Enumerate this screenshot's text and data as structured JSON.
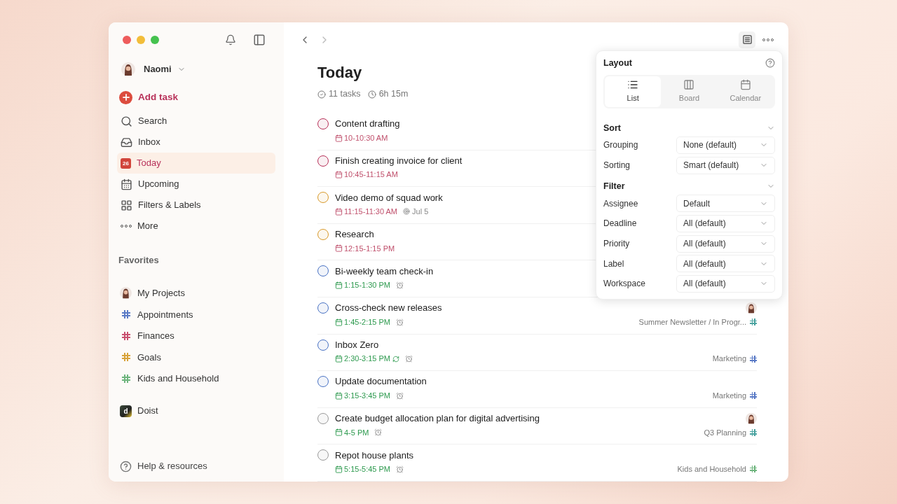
{
  "sidebar": {
    "user": {
      "name": "Naomi"
    },
    "add_task": "Add task",
    "nav": [
      {
        "kind": "search",
        "label": "Search",
        "selected": false
      },
      {
        "kind": "inbox",
        "label": "Inbox",
        "selected": false
      },
      {
        "kind": "today",
        "label": "Today",
        "selected": true,
        "badge": "26"
      },
      {
        "kind": "upcoming",
        "label": "Upcoming",
        "selected": false
      },
      {
        "kind": "filters",
        "label": "Filters & Labels",
        "selected": false
      },
      {
        "kind": "more",
        "label": "More",
        "selected": false
      }
    ],
    "favorites_heading": "Favorites",
    "favorites": [
      {
        "kind": "person",
        "label": "My Projects"
      },
      {
        "kind": "project",
        "label": "Appointments",
        "color": "#5b7bc6"
      },
      {
        "kind": "project",
        "label": "Finances",
        "color": "#c9506f"
      },
      {
        "kind": "project",
        "label": "Goals",
        "color": "#d8a33a"
      },
      {
        "kind": "project",
        "label": "Kids and Household",
        "color": "#6fb57e"
      }
    ],
    "workspace": {
      "label": "Doist",
      "logo": "d"
    },
    "help": "Help & resources"
  },
  "page": {
    "title": "Today",
    "task_count": "11 tasks",
    "duration": "6h 15m"
  },
  "tasks": [
    {
      "title": "Content drafting",
      "time": "10-10:30 AM",
      "overdue": true,
      "color": "#b8325a",
      "reminder": false,
      "recurring": false
    },
    {
      "title": "Finish creating invoice for client",
      "time": "10:45-11:15 AM",
      "overdue": true,
      "color": "#b8325a",
      "reminder": false,
      "recurring": false
    },
    {
      "title": "Video demo of squad work",
      "time": "11:15-11:30 AM",
      "overdue": true,
      "color": "#d99a2b",
      "reminder": false,
      "recurring": false,
      "deadline": "Jul 5"
    },
    {
      "title": "Research",
      "time": "12:15-1:15 PM",
      "overdue": true,
      "color": "#d99a2b",
      "reminder": false,
      "recurring": false
    },
    {
      "title": "Bi-weekly team check-in",
      "time": "1:15-1:30 PM",
      "overdue": false,
      "color": "#4a73c4",
      "reminder": true,
      "recurring": false
    },
    {
      "title": "Cross-check new releases",
      "time": "1:45-2:15 PM",
      "overdue": false,
      "color": "#4a73c4",
      "reminder": true,
      "recurring": false,
      "assigned": true,
      "project": {
        "name": "Summer Newsletter / In Progr...",
        "color": "#4aa3a0"
      }
    },
    {
      "title": "Inbox Zero",
      "time": "2:30-3:15 PM",
      "overdue": false,
      "color": "#4a73c4",
      "reminder": true,
      "recurring": true,
      "project": {
        "name": "Marketing",
        "color": "#5b7bc6"
      }
    },
    {
      "title": "Update documentation",
      "time": "3:15-3:45 PM",
      "overdue": false,
      "color": "#4a73c4",
      "reminder": true,
      "recurring": false,
      "project": {
        "name": "Marketing",
        "color": "#5b7bc6"
      }
    },
    {
      "title": "Create budget allocation plan for digital advertising",
      "time": "4-5 PM",
      "overdue": false,
      "color": "#9a9a9a",
      "reminder": true,
      "recurring": false,
      "assigned": true,
      "project": {
        "name": "Q3 Planning",
        "color": "#4aa3a0"
      }
    },
    {
      "title": "Repot house plants",
      "time": "5:15-5:45 PM",
      "overdue": false,
      "color": "#9a9a9a",
      "reminder": true,
      "recurring": false,
      "project": {
        "name": "Kids and Household",
        "color": "#6fb57e"
      }
    }
  ],
  "view_menu": {
    "layout_heading": "Layout",
    "layouts": [
      {
        "kind": "list",
        "label": "List",
        "selected": true
      },
      {
        "kind": "board",
        "label": "Board",
        "selected": false
      },
      {
        "kind": "calendar",
        "label": "Calendar",
        "selected": false
      }
    ],
    "sections": [
      {
        "heading": "Sort",
        "options": [
          {
            "label": "Grouping",
            "value": "None (default)"
          },
          {
            "label": "Sorting",
            "value": "Smart (default)"
          }
        ]
      },
      {
        "heading": "Filter",
        "options": [
          {
            "label": "Assignee",
            "value": "Default"
          },
          {
            "label": "Deadline",
            "value": "All (default)"
          },
          {
            "label": "Priority",
            "value": "All (default)"
          },
          {
            "label": "Label",
            "value": "All (default)"
          },
          {
            "label": "Workspace",
            "value": "All (default)"
          }
        ]
      }
    ]
  }
}
